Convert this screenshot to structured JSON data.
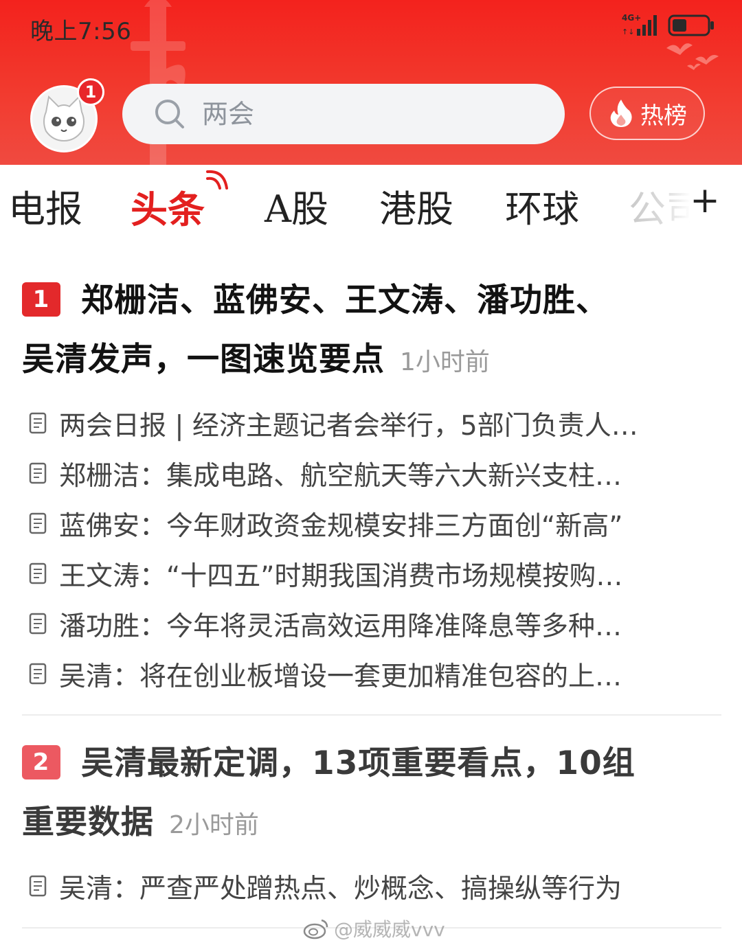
{
  "status_bar": {
    "time": "晚上7:56",
    "network": "4G+"
  },
  "header": {
    "avatar_badge": "1",
    "search": {
      "placeholder": "两会",
      "value": ""
    },
    "hot_button": "热榜",
    "colors": {
      "header_red": "#f3221d",
      "accent_red": "#e3201f"
    }
  },
  "tabs": [
    {
      "label": "电报",
      "active": false
    },
    {
      "label": "头条",
      "active": true
    },
    {
      "label": "A股",
      "active": false
    },
    {
      "label": "港股",
      "active": false
    },
    {
      "label": "环球",
      "active": false
    },
    {
      "label": "公司",
      "active": false
    }
  ],
  "tabs_add_label": "+",
  "news": [
    {
      "rank": "1",
      "headline_line1": "郑栅洁、蓝佛安、王文涛、潘功胜、",
      "headline_line2": "吴清发声，一图速览要点",
      "time": "1小时前",
      "subs": [
        "两会日报 | 经济主题记者会举行，5部门负责人…",
        "郑栅洁：集成电路、航空航天等六大新兴支柱…",
        "蓝佛安：今年财政资金规模安排三方面创“新高”",
        "王文涛：“十四五”时期我国消费市场规模按购…",
        "潘功胜：今年将灵活高效运用降准降息等多种…",
        "吴清：将在创业板增设一套更加精准包容的上…"
      ]
    },
    {
      "rank": "2",
      "headline_line1": "吴清最新定调，13项重要看点，10组",
      "headline_line2": "重要数据",
      "time": "2小时前",
      "subs": [
        "吴清：严查严处蹭热点、炒概念、搞操纵等行为"
      ]
    }
  ],
  "watermark": "@威威威vvv"
}
